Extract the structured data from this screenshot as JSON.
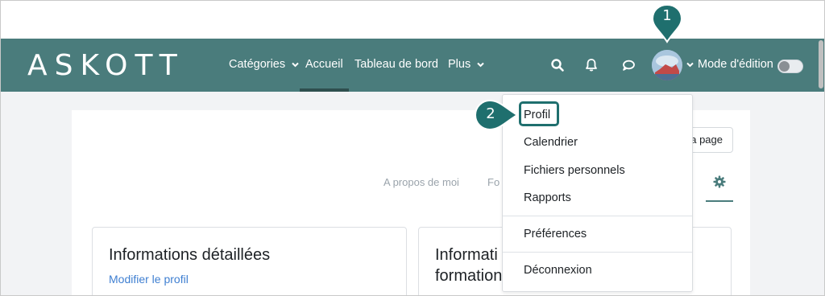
{
  "brand": {
    "logo_text": "ASKOTT"
  },
  "nav": {
    "items": [
      {
        "label": "Catégories",
        "has_chevron": true
      },
      {
        "label": "Accueil",
        "active": true
      },
      {
        "label": "Tableau de bord"
      },
      {
        "label": "Plus",
        "has_chevron": true
      }
    ],
    "icons": [
      "search-icon",
      "bell-icon",
      "chat-icon"
    ],
    "edit_mode_label": "Mode d'édition",
    "edit_mode_on": false
  },
  "dropdown": {
    "items": [
      {
        "label": "Profil",
        "highlighted": true
      },
      {
        "label": "Calendrier"
      },
      {
        "label": "Fichiers personnels"
      },
      {
        "label": "Rapports"
      },
      {
        "label": "Préférences"
      },
      {
        "label": "Déconnexion"
      }
    ]
  },
  "page": {
    "reset_button_label": "a page",
    "tabs": [
      {
        "label": "A propos de moi"
      },
      {
        "label": "Fo"
      }
    ],
    "settings_icon": "gear-icon"
  },
  "cards": [
    {
      "title": "Informations détaillées",
      "link": "Modifier le profil"
    },
    {
      "title_line1": "Informati",
      "title_line2": "formation"
    }
  ],
  "callouts": [
    "1",
    "2"
  ],
  "colors": {
    "navbar": "#4a7c7c",
    "callout": "#1f6f6e",
    "link": "#3f7fd1"
  }
}
